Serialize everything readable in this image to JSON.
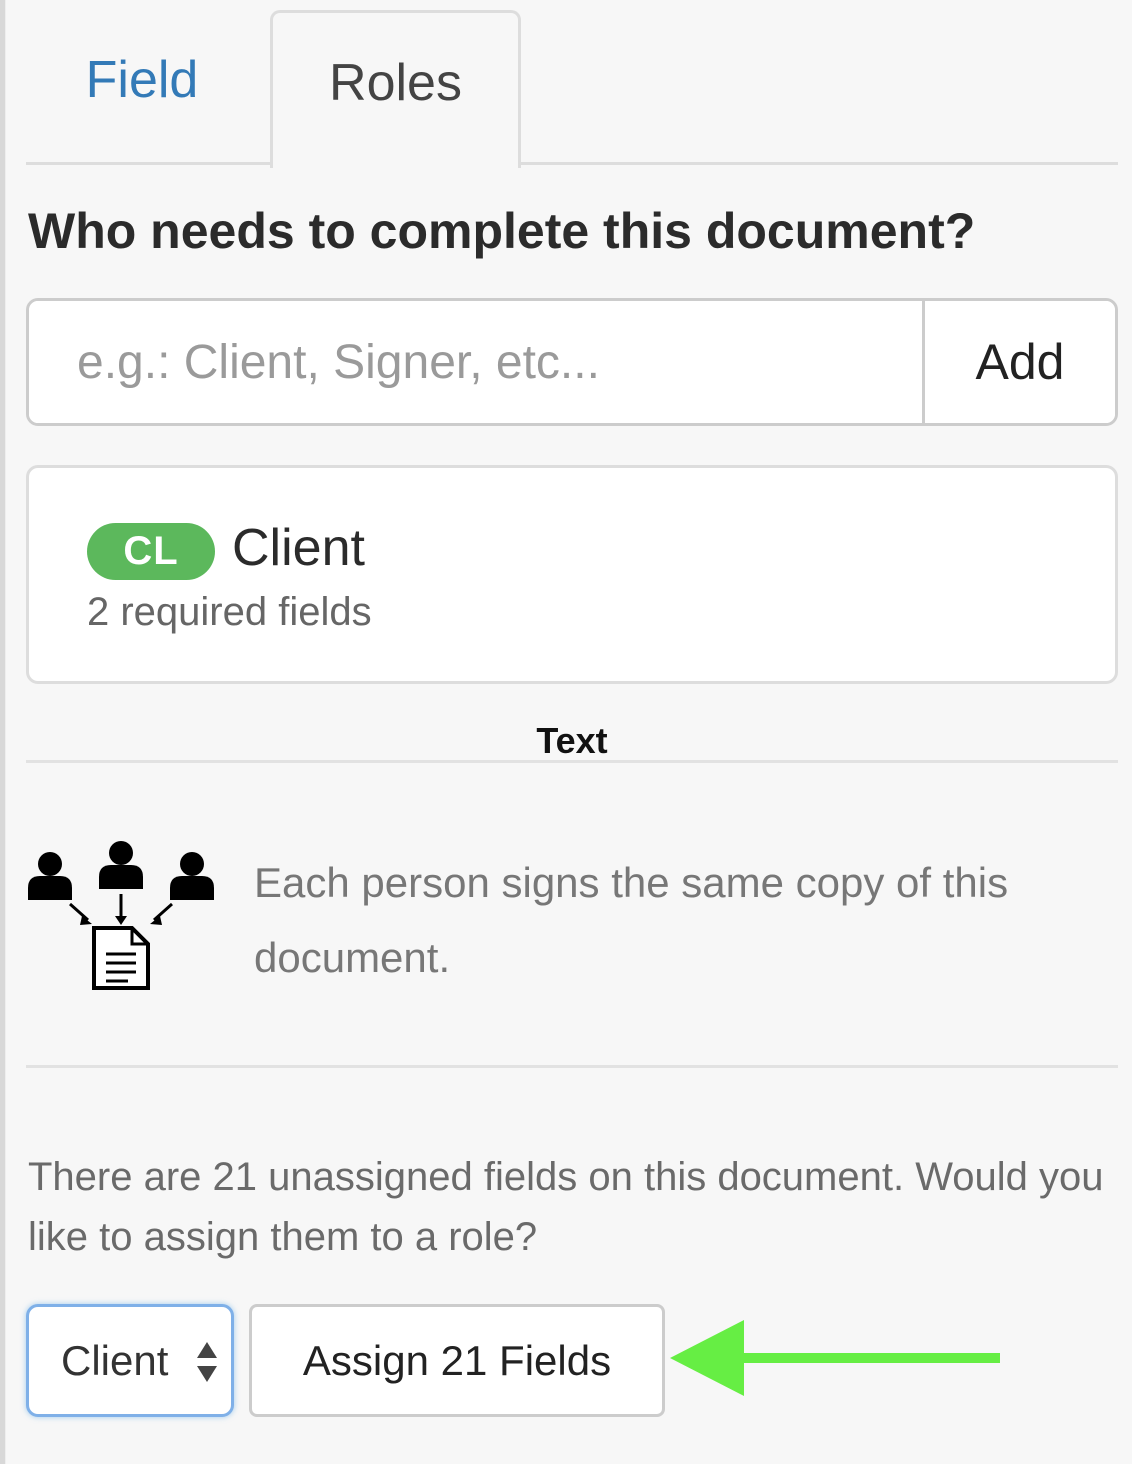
{
  "tabs": [
    {
      "label": "Field",
      "active": false
    },
    {
      "label": "Roles",
      "active": true
    }
  ],
  "roles_panel": {
    "question": "Who needs to complete this document?",
    "role_input": {
      "placeholder": "e.g.: Client, Signer, etc...",
      "value": ""
    },
    "add_label": "Add",
    "roles": [
      {
        "badge": "CL",
        "badge_color": "#5cb85c",
        "name": "Client",
        "required_fields": "2 required fields"
      }
    ],
    "section_heading": "Text",
    "signing_mode": {
      "icon": "people-to-document-icon",
      "description": "Each person signs the same copy of this document."
    },
    "unassigned_message": "There are 21 unassigned fields on this document. Would you like to assign them to a role?",
    "role_select": {
      "selected": "Client"
    },
    "assign_label": "Assign 21 Fields",
    "annotation_arrow_color": "#66ee44"
  }
}
